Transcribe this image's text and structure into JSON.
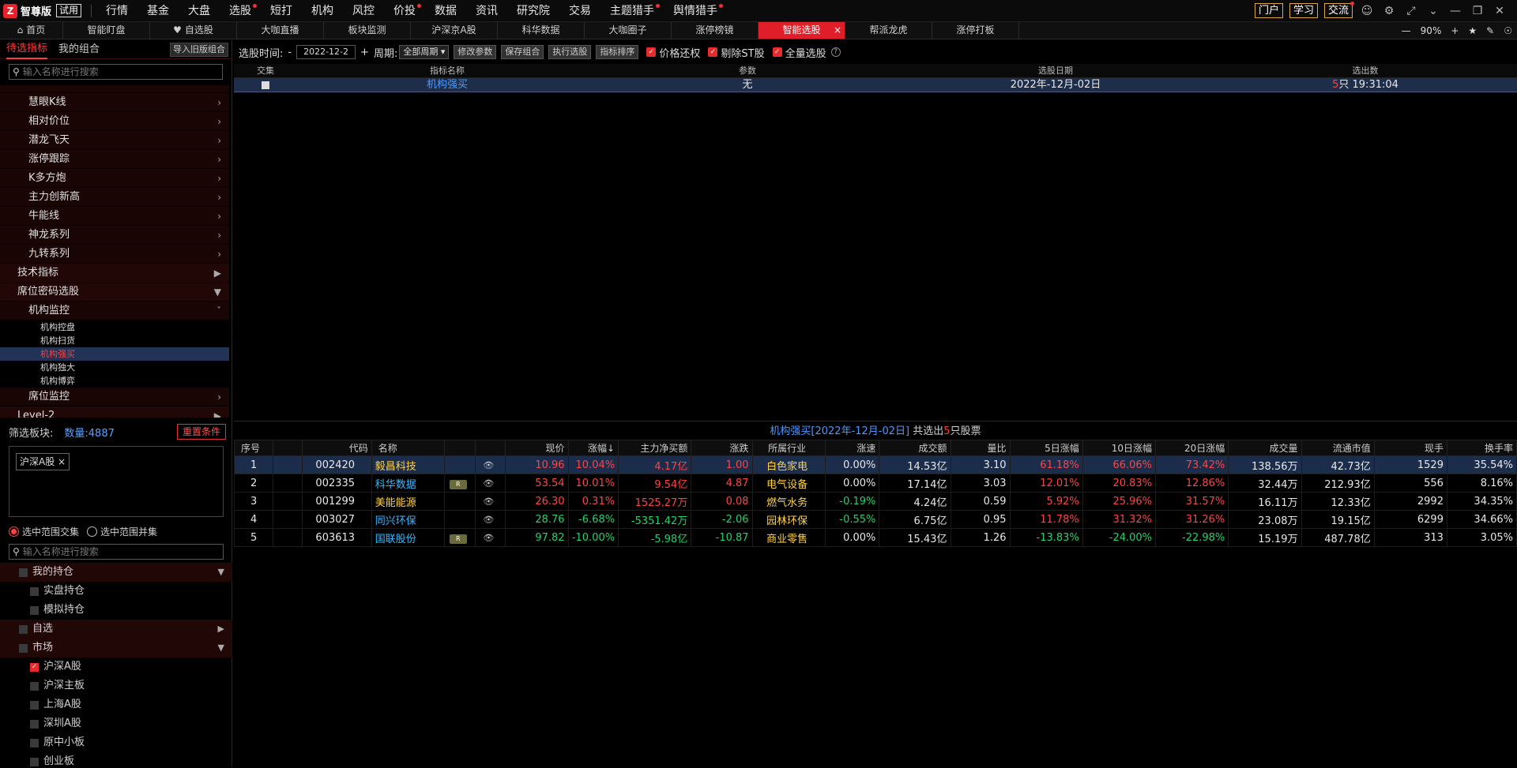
{
  "app": {
    "logo_mark": "Z",
    "brand": "智尊版",
    "trial": "试用"
  },
  "menu": [
    {
      "label": "行情",
      "dot": false
    },
    {
      "label": "基金",
      "dot": false
    },
    {
      "label": "大盘",
      "dot": false
    },
    {
      "label": "选股",
      "dot": true
    },
    {
      "label": "短打",
      "dot": false
    },
    {
      "label": "机构",
      "dot": false
    },
    {
      "label": "风控",
      "dot": false
    },
    {
      "label": "价投",
      "dot": true
    },
    {
      "label": "数据",
      "dot": false
    },
    {
      "label": "资讯",
      "dot": false
    },
    {
      "label": "研究院",
      "dot": false
    },
    {
      "label": "交易",
      "dot": false
    },
    {
      "label": "主题猎手",
      "dot": true
    },
    {
      "label": "舆情猎手",
      "dot": true
    }
  ],
  "menu_right": {
    "portal": "门户",
    "learn": "学习",
    "exchange": "交流"
  },
  "tabs": [
    {
      "label": "首页"
    },
    {
      "label": "智能盯盘"
    },
    {
      "label": "自选股"
    },
    {
      "label": "大咖直播"
    },
    {
      "label": "板块监测"
    },
    {
      "label": "沪深京A股"
    },
    {
      "label": "科华数据"
    },
    {
      "label": "大咖圈子"
    },
    {
      "label": "涨停榜镜"
    },
    {
      "label": "智能选股"
    },
    {
      "label": "帮派龙虎"
    },
    {
      "label": "涨停打板"
    }
  ],
  "tab_icons": {
    "home": "⌂",
    "heart": "♥"
  },
  "zoom": "90%",
  "left": {
    "tab1": "待选指标",
    "tab2": "我的组合",
    "import_btn": "导入旧版组合",
    "search_placeholder": "输入名称进行搜索",
    "tree_top": [
      {
        "label": "慧眼K线"
      },
      {
        "label": "相对价位"
      },
      {
        "label": "潜龙飞天"
      },
      {
        "label": "涨停跟踪"
      },
      {
        "label": "K多方炮"
      },
      {
        "label": "主力创新高"
      },
      {
        "label": "牛能线"
      },
      {
        "label": "神龙系列"
      },
      {
        "label": "九转系列"
      }
    ],
    "tech": "技术指标",
    "seat": "席位密码选股",
    "inst_monitor": "机构监控",
    "subs": [
      {
        "label": "机构控盘"
      },
      {
        "label": "机构扫货"
      },
      {
        "label": "机构强买"
      },
      {
        "label": "机构独大"
      },
      {
        "label": "机构博弈"
      }
    ],
    "seat_monitor": "席位监控",
    "level2": "Level-2",
    "filter_label": "筛选板块:",
    "filter_count": "数量:4887",
    "reset": "重置条件",
    "chip": "沪深A股",
    "chip_x": "×",
    "radio1": "选中范围交集",
    "radio2": "选中范围并集",
    "search2_placeholder": "输入名称进行搜索",
    "market_tree": [
      {
        "label": "我的持仓",
        "type": "grp",
        "arrow": "▼",
        "check": false
      },
      {
        "label": "实盘持仓",
        "type": "itm",
        "check": false
      },
      {
        "label": "模拟持仓",
        "type": "itm",
        "check": false
      },
      {
        "label": "自选",
        "type": "grp",
        "arrow": "▶",
        "check": false
      },
      {
        "label": "市场",
        "type": "grp",
        "arrow": "▼",
        "check": false
      },
      {
        "label": "沪深A股",
        "type": "itm",
        "check": true
      },
      {
        "label": "沪深主板",
        "type": "itm",
        "check": false
      },
      {
        "label": "上海A股",
        "type": "itm",
        "check": false
      },
      {
        "label": "深圳A股",
        "type": "itm",
        "check": false
      },
      {
        "label": "原中小板",
        "type": "itm",
        "check": false
      },
      {
        "label": "创业板",
        "type": "itm",
        "check": false
      }
    ]
  },
  "toolbar": {
    "time_label": "选股时间:",
    "dash": "-",
    "date": "2022-12-2",
    "plus": "+",
    "period_label": "周期:",
    "period": "全部周期",
    "btn_modify": "修改参数",
    "btn_save": "保存组合",
    "btn_exec": "执行选股",
    "btn_sort": "指标排序",
    "chk1": "价格还权",
    "chk2": "剔除ST股",
    "chk3": "全量选股"
  },
  "upper": {
    "headers": [
      "交集",
      "指标名称",
      "参数",
      "选股日期",
      "选出数"
    ],
    "row": {
      "name": "机构强买",
      "param": "无",
      "date": "2022年-12月-02日",
      "count": "5",
      "unit": "只",
      "time": "19:31:04"
    }
  },
  "result": {
    "title_name": "机构强买",
    "title_date": "[2022年-12月-02日]",
    "title_mid": "共选出",
    "title_count": "5",
    "title_end": "只股票"
  },
  "columns": [
    "序号",
    "",
    "代码",
    "名称",
    "",
    "",
    "现价",
    "涨幅↓",
    "主力净买额",
    "涨跌",
    "所属行业",
    "涨速",
    "成交额",
    "量比",
    "5日涨幅",
    "10日涨幅",
    "20日涨幅",
    "成交量",
    "流通市值",
    "现手",
    "换手率"
  ],
  "rows": [
    {
      "no": "1",
      "code": "002420",
      "name": "毅昌科技",
      "r": false,
      "price": "10.96",
      "pct": "10.04%",
      "net": "4.17亿",
      "chg": "1.00",
      "ind": "白色家电",
      "spd": "0.00%",
      "amt": "14.53亿",
      "vr": "3.10",
      "d5": "61.18%",
      "d10": "66.06%",
      "d20": "73.42%",
      "vol": "138.56万",
      "mcap": "42.73亿",
      "hand": "1529",
      "turn": "35.54%"
    },
    {
      "no": "2",
      "code": "002335",
      "name": "科华数据",
      "r": true,
      "price": "53.54",
      "pct": "10.01%",
      "net": "9.54亿",
      "chg": "4.87",
      "ind": "电气设备",
      "spd": "0.00%",
      "amt": "17.14亿",
      "vr": "3.03",
      "d5": "12.01%",
      "d10": "20.83%",
      "d20": "12.86%",
      "vol": "32.44万",
      "mcap": "212.93亿",
      "hand": "556",
      "turn": "8.16%"
    },
    {
      "no": "3",
      "code": "001299",
      "name": "美能能源",
      "r": false,
      "price": "26.30",
      "pct": "0.31%",
      "net": "1525.27万",
      "chg": "0.08",
      "ind": "燃气水务",
      "spd": "-0.19%",
      "amt": "4.24亿",
      "vr": "0.59",
      "d5": "5.92%",
      "d10": "25.96%",
      "d20": "31.57%",
      "vol": "16.11万",
      "mcap": "12.33亿",
      "hand": "2992",
      "turn": "34.35%"
    },
    {
      "no": "4",
      "code": "003027",
      "name": "同兴环保",
      "r": false,
      "price": "28.76",
      "pct": "-6.68%",
      "net": "-5351.42万",
      "chg": "-2.06",
      "ind": "园林环保",
      "spd": "-0.55%",
      "amt": "6.75亿",
      "vr": "0.95",
      "d5": "11.78%",
      "d10": "31.32%",
      "d20": "31.26%",
      "vol": "23.08万",
      "mcap": "19.15亿",
      "hand": "6299",
      "turn": "34.66%"
    },
    {
      "no": "5",
      "code": "603613",
      "name": "国联股份",
      "r": true,
      "price": "97.82",
      "pct": "-10.00%",
      "net": "-5.98亿",
      "chg": "-10.87",
      "ind": "商业零售",
      "spd": "0.00%",
      "amt": "15.43亿",
      "vr": "1.26",
      "d5": "-13.83%",
      "d10": "-24.00%",
      "d20": "-22.98%",
      "vol": "15.19万",
      "mcap": "487.78亿",
      "hand": "313",
      "turn": "3.05%"
    }
  ],
  "row_flags": {
    "r_label": "R",
    "eye": "👁"
  }
}
